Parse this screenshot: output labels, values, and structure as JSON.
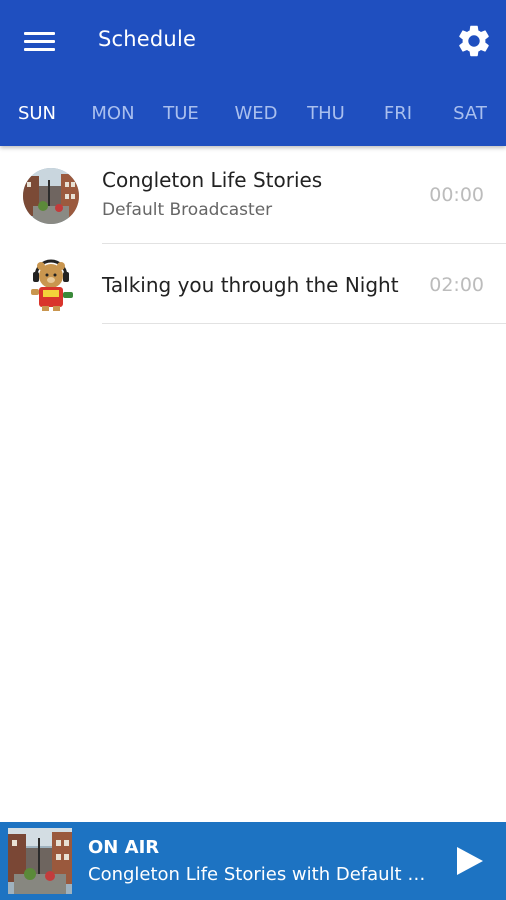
{
  "header": {
    "title": "Schedule"
  },
  "tabs": [
    {
      "label": "SUN",
      "active": true
    },
    {
      "label": "MON",
      "active": false
    },
    {
      "label": "TUE",
      "active": false
    },
    {
      "label": "WED",
      "active": false
    },
    {
      "label": "THU",
      "active": false
    },
    {
      "label": "FRI",
      "active": false
    },
    {
      "label": "SAT",
      "active": false
    }
  ],
  "schedule": [
    {
      "title": "Congleton Life Stories",
      "subtitle": "Default Broadcaster",
      "time": "00:00",
      "avatar_icon": "street-photo-avatar"
    },
    {
      "title": "Talking you through the Night",
      "subtitle": "",
      "time": "02:00",
      "avatar_icon": "teddy-bear-headphones-avatar"
    }
  ],
  "player": {
    "status": "ON AIR",
    "now_playing": "Congleton Life Stories with Default Broadcaster",
    "thumbnail_icon": "street-photo-thumbnail",
    "play_icon": "play-icon"
  },
  "colors": {
    "appbar": "#1f4fbf",
    "player": "#1d73c2",
    "tab_inactive": "#a9bfee"
  }
}
